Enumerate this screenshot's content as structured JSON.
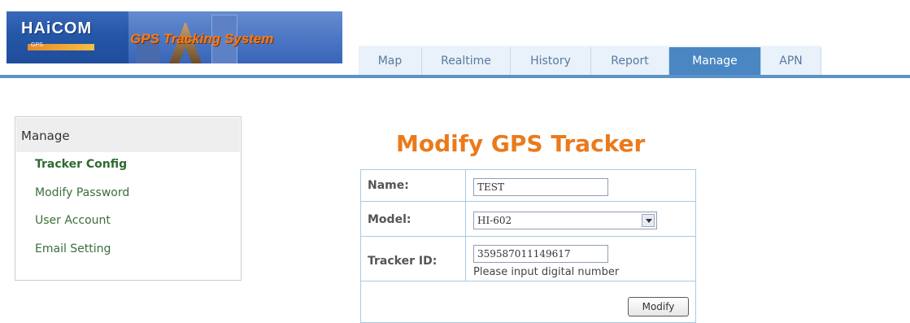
{
  "header": {
    "brand": "HAiCOM",
    "brand_sub": "GPS",
    "system_title": "GPS Tracking System"
  },
  "nav": {
    "tabs": [
      {
        "label": "Map",
        "active": false
      },
      {
        "label": "Realtime",
        "active": false
      },
      {
        "label": "History",
        "active": false
      },
      {
        "label": "Report",
        "active": false
      },
      {
        "label": "Manage",
        "active": true
      },
      {
        "label": "APN",
        "active": false
      }
    ]
  },
  "sidebar": {
    "title": "Manage",
    "items": [
      {
        "label": "Tracker Config",
        "active": true
      },
      {
        "label": "Modify Password",
        "active": false
      },
      {
        "label": "User Account",
        "active": false
      },
      {
        "label": "Email Setting",
        "active": false
      }
    ]
  },
  "form": {
    "title": "Modify GPS Tracker",
    "name_label": "Name:",
    "name_value": "TEST",
    "model_label": "Model:",
    "model_value": "HI-602",
    "tracker_id_label": "Tracker ID:",
    "tracker_id_value": "359587011149617",
    "tracker_id_hint": "Please input digital number",
    "submit_label": "Modify"
  },
  "colors": {
    "accent": "#4a87c2",
    "title_orange": "#ea7a1c",
    "sidebar_link": "#3a6e3a"
  }
}
